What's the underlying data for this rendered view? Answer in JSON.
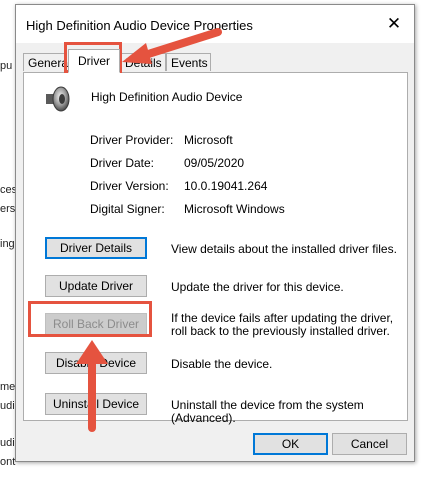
{
  "background": {
    "fragments": [
      "pu",
      "ces",
      "ers",
      "ing",
      "me",
      "udi",
      "udi",
      "ont"
    ]
  },
  "dialog": {
    "title": "High Definition Audio Device Properties",
    "close_glyph": "✕",
    "tabs": [
      {
        "label": "General",
        "active": false
      },
      {
        "label": "Driver",
        "active": true
      },
      {
        "label": "Details",
        "active": false
      },
      {
        "label": "Events",
        "active": false
      }
    ],
    "device_name": "High Definition Audio Device",
    "device_icon": "speaker-icon",
    "info": [
      {
        "label": "Driver Provider:",
        "value": "Microsoft"
      },
      {
        "label": "Driver Date:",
        "value": "09/05/2020"
      },
      {
        "label": "Driver Version:",
        "value": "10.0.19041.264"
      },
      {
        "label": "Digital Signer:",
        "value": "Microsoft Windows"
      }
    ],
    "actions": [
      {
        "label": "Driver Details",
        "description": "View details about the installed driver files.",
        "enabled": true
      },
      {
        "label": "Update Driver",
        "description": "Update the driver for this device.",
        "enabled": true
      },
      {
        "label": "Roll Back Driver",
        "description": "If the device fails after updating the driver, roll back to the previously installed driver.",
        "enabled": false
      },
      {
        "label": "Disable Device",
        "description": "Disable the device.",
        "enabled": true
      },
      {
        "label": "Uninstall Device",
        "description": "Uninstall the device from the system (Advanced).",
        "enabled": true
      }
    ],
    "ok_label": "OK",
    "cancel_label": "Cancel"
  },
  "annotation_color": "#e5533f"
}
